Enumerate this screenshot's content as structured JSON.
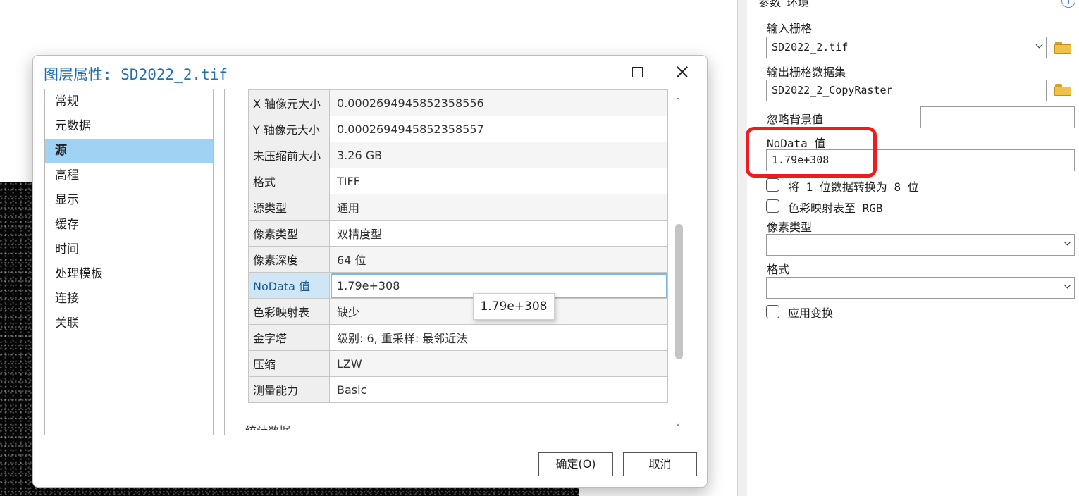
{
  "dialog": {
    "title": "图层属性: SD2022_2.tif",
    "nav_items": [
      "常规",
      "元数据",
      "源",
      "高程",
      "显示",
      "缓存",
      "时间",
      "处理模板",
      "连接",
      "关联"
    ],
    "active_nav": "源",
    "properties": [
      {
        "key": "X 轴像元大小",
        "value": "0.0002694945852358556"
      },
      {
        "key": "Y 轴像元大小",
        "value": "0.0002694945852358557"
      },
      {
        "key": "未压缩前大小",
        "value": "3.26 GB"
      },
      {
        "key": "格式",
        "value": "TIFF"
      },
      {
        "key": "源类型",
        "value": "通用"
      },
      {
        "key": "像素类型",
        "value": "双精度型"
      },
      {
        "key": "像素深度",
        "value": "64 位"
      },
      {
        "key": "NoData 值",
        "value": "1.79e+308"
      },
      {
        "key": "色彩映射表",
        "value": "缺少"
      },
      {
        "key": "金字塔",
        "value": "级别: 6, 重采样: 最邻近法"
      },
      {
        "key": "压缩",
        "value": "LZW"
      },
      {
        "key": "测量能力",
        "value": "Basic"
      }
    ],
    "partially_visible_heading": "统计数据",
    "tooltip": "1.79e+308",
    "ok_button": "确定(O)",
    "cancel_button": "取消"
  },
  "gp_pane": {
    "tabs": [
      "参数",
      "环境"
    ],
    "input_raster_label": "输入栅格",
    "input_raster_value": "SD2022_2.tif",
    "output_dataset_label": "输出栅格数据集",
    "output_dataset_value": "SD2022_2_CopyRaster",
    "ignore_bg_label": "忽略背景值",
    "ignore_bg_value": "",
    "nodata_label": "NoData 值",
    "nodata_value": "1.79e+308",
    "convert_1bit_label": "将 1 位数据转换为 8 位",
    "colormap_rgb_label": "色彩映射表至 RGB",
    "pixel_type_label": "像素类型",
    "pixel_type_value": "",
    "format_label": "格式",
    "format_value": "",
    "apply_transform_label": "应用变换"
  },
  "colors": {
    "accent": "#1f6fb5",
    "selected_nav": "#9fd2f3",
    "highlight_box": "#ef1c1c"
  }
}
